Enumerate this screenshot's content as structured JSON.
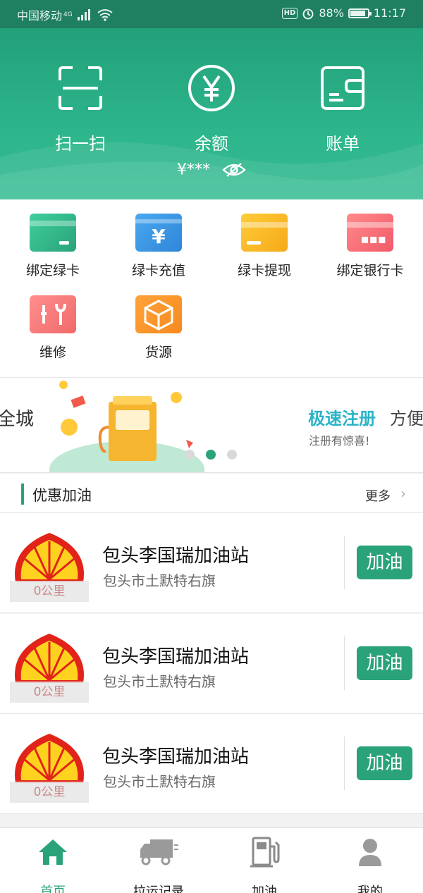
{
  "status": {
    "carrier": "中国移动",
    "net": "4G",
    "hd": "HD",
    "battery": "88%",
    "battery_level": 0.88,
    "time": "11:17"
  },
  "header": {
    "actions": [
      {
        "label": "扫一扫",
        "icon": "scan-icon"
      },
      {
        "label": "余额",
        "icon": "yen-icon"
      },
      {
        "label": "账单",
        "icon": "wallet-icon"
      }
    ],
    "balance_masked": "¥***",
    "accent": "#2db58c"
  },
  "services": [
    {
      "label": "绑定绿卡",
      "icon": "green-card-icon"
    },
    {
      "label": "绿卡充值",
      "icon": "card-recharge-icon"
    },
    {
      "label": "绿卡提现",
      "icon": "card-withdraw-icon"
    },
    {
      "label": "绑定银行卡",
      "icon": "bank-card-icon"
    },
    {
      "label": "维修",
      "icon": "repair-icon"
    },
    {
      "label": "货源",
      "icon": "cargo-box-icon"
    }
  ],
  "banner": {
    "left_text": "全城",
    "title": "极速注册",
    "title_suffix": "方便",
    "subtitle": "注册有惊喜!",
    "page_count": 3,
    "active_page": 2
  },
  "section": {
    "title": "优惠加油",
    "more": "更多"
  },
  "stations": [
    {
      "name": "包头李国瑞加油站",
      "address": "包头市土默特右旗",
      "distance": "0公里",
      "button": "加油"
    },
    {
      "name": "包头李国瑞加油站",
      "address": "包头市土默特右旗",
      "distance": "0公里",
      "button": "加油"
    },
    {
      "name": "包头李国瑞加油站",
      "address": "包头市土默特右旗",
      "distance": "0公里",
      "button": "加油"
    }
  ],
  "nav": [
    {
      "label": "首页",
      "icon": "home-icon",
      "active": true
    },
    {
      "label": "拉运记录",
      "icon": "truck-icon",
      "active": false
    },
    {
      "label": "加油",
      "icon": "fuel-pump-icon",
      "active": false
    },
    {
      "label": "我的",
      "icon": "user-icon",
      "active": false
    }
  ]
}
